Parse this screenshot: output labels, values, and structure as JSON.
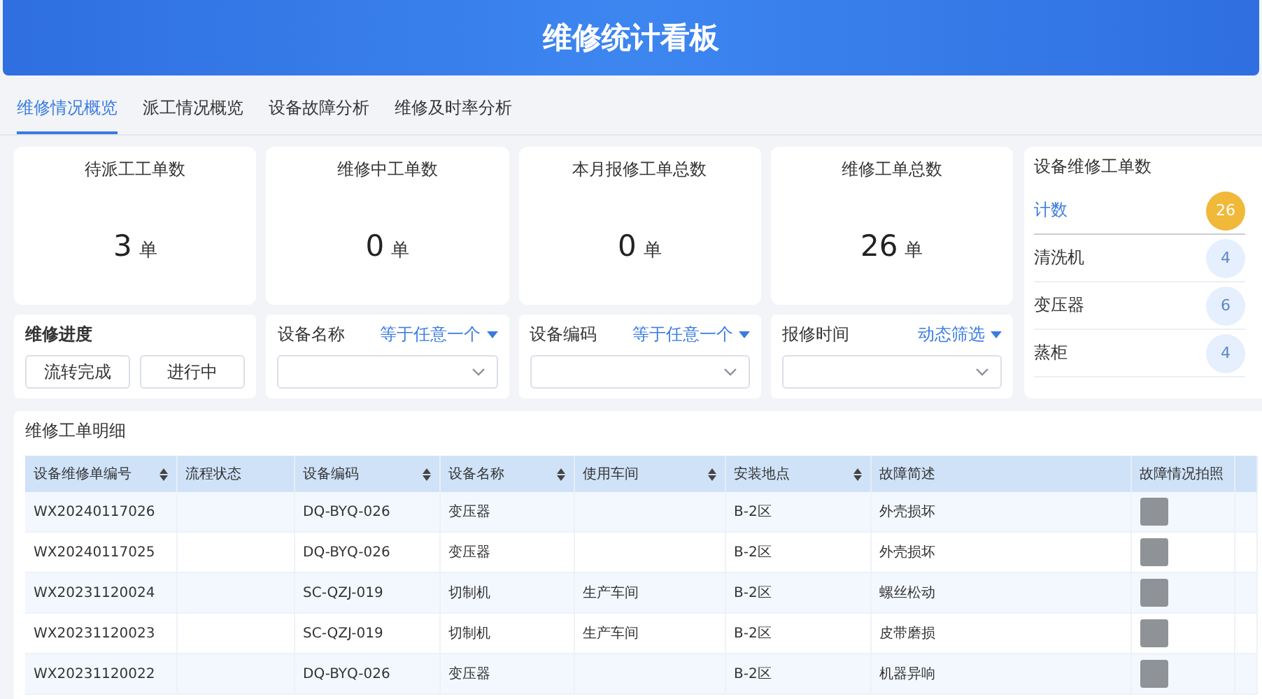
{
  "header": {
    "title": "维修统计看板"
  },
  "tabs": [
    {
      "label": "维修情况概览",
      "selected": true
    },
    {
      "label": "派工情况概览",
      "selected": false
    },
    {
      "label": "设备故障分析",
      "selected": false
    },
    {
      "label": "维修及时率分析",
      "selected": false
    }
  ],
  "stat_cards": [
    {
      "title": "待派工工单数",
      "value": "3",
      "unit": "单"
    },
    {
      "title": "维修中工单数",
      "value": "0",
      "unit": "单"
    },
    {
      "title": "本月报修工单总数",
      "value": "0",
      "unit": "单"
    },
    {
      "title": "维修工单总数",
      "value": "26",
      "unit": "单"
    }
  ],
  "equipment_counts": {
    "title": "设备维修工单数",
    "items": [
      {
        "kind": "total",
        "label": "计数",
        "count": "26"
      },
      {
        "kind": "item",
        "label": "清洗机",
        "count": "4"
      },
      {
        "kind": "item",
        "label": "变压器",
        "count": "6"
      },
      {
        "kind": "item",
        "label": "蒸柜",
        "count": "4"
      }
    ]
  },
  "progress": {
    "title": "维修进度",
    "buttons": [
      "流转完成",
      "进行中"
    ]
  },
  "filters": [
    {
      "label": "设备名称",
      "mode": "等于任意一个"
    },
    {
      "label": "设备编码",
      "mode": "等于任意一个"
    },
    {
      "label": "报修时间",
      "mode": "动态筛选"
    }
  ],
  "table": {
    "title": "维修工单明细",
    "columns": [
      {
        "label": "设备维修单编号",
        "sortable": true
      },
      {
        "label": "流程状态",
        "sortable": false
      },
      {
        "label": "设备编码",
        "sortable": true
      },
      {
        "label": "设备名称",
        "sortable": true
      },
      {
        "label": "使用车间",
        "sortable": true
      },
      {
        "label": "安装地点",
        "sortable": true
      },
      {
        "label": "故障简述",
        "sortable": false
      },
      {
        "label": "故障情况拍照",
        "sortable": false
      }
    ],
    "rows": [
      {
        "cells": [
          "WX20240117026",
          "",
          "DQ-BYQ-026",
          "变压器",
          "",
          "B-2区",
          "外壳损坏"
        ],
        "photo": true
      },
      {
        "cells": [
          "WX20240117025",
          "",
          "DQ-BYQ-026",
          "变压器",
          "",
          "B-2区",
          "外壳损坏"
        ],
        "photo": true
      },
      {
        "cells": [
          "WX20231120024",
          "",
          "SC-QZJ-019",
          "切制机",
          "生产车间",
          "B-2区",
          "螺丝松动"
        ],
        "photo": true
      },
      {
        "cells": [
          "WX20231120023",
          "",
          "SC-QZJ-019",
          "切制机",
          "生产车间",
          "B-2区",
          "皮带磨损"
        ],
        "photo": true
      },
      {
        "cells": [
          "WX20231120022",
          "",
          "DQ-BYQ-026",
          "变压器",
          "",
          "B-2区",
          "机器异响"
        ],
        "photo": true
      }
    ]
  }
}
